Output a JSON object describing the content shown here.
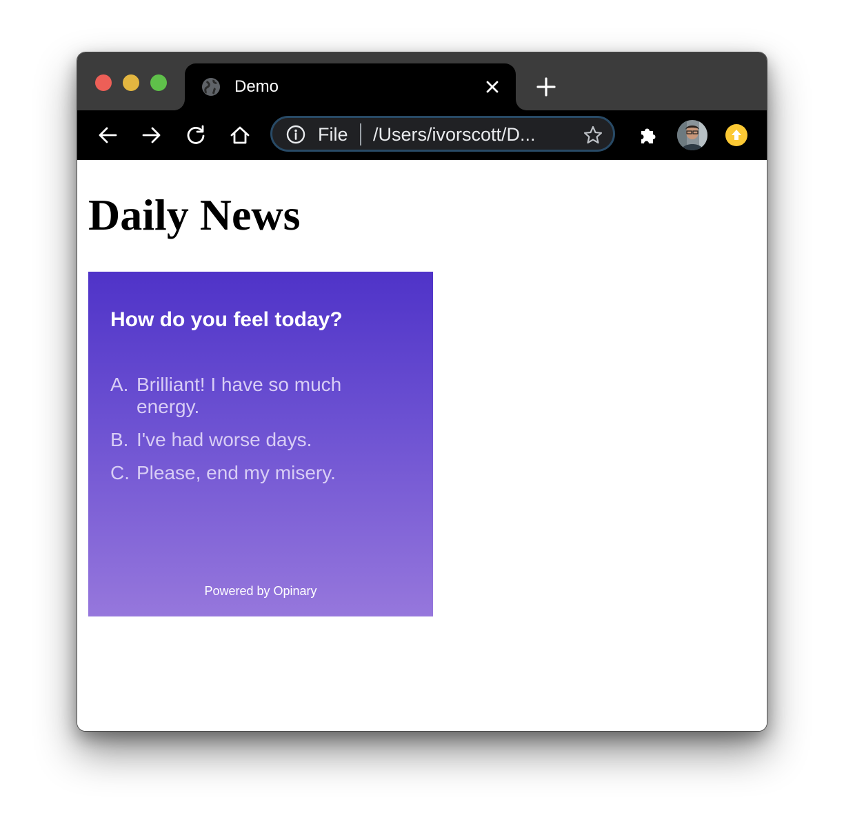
{
  "browser": {
    "tab": {
      "title": "Demo",
      "favicon_icon": "globe-icon",
      "close_icon": "close-icon"
    },
    "new_tab_icon": "plus-icon",
    "nav": {
      "back_icon": "arrow-left-icon",
      "forward_icon": "arrow-right-icon",
      "reload_icon": "reload-icon",
      "home_icon": "home-icon"
    },
    "omnibox": {
      "info_icon": "info-icon",
      "scheme": "File",
      "url": "/Users/ivorscott/D...",
      "bookmark_icon": "star-icon"
    },
    "extensions_icon": "puzzle-icon",
    "avatar_icon": "profile-avatar",
    "update_icon": "update-arrow-icon",
    "colors": {
      "titlebar": "#3c3c3c",
      "toolbar": "#000000",
      "omnibox_border": "#284a66"
    }
  },
  "page": {
    "headline": "Daily News",
    "poll": {
      "question": "How do you feel today?",
      "options": [
        {
          "letter": "A.",
          "text": "Brilliant! I have so much energy."
        },
        {
          "letter": "B.",
          "text": "I've had worse days."
        },
        {
          "letter": "C.",
          "text": "Please, end my misery."
        }
      ],
      "footer": "Powered by Opinary",
      "colors": {
        "gradient_top": "#4f33c8",
        "gradient_bottom": "#9677dc",
        "option_text": "#d8cdf5"
      }
    }
  }
}
